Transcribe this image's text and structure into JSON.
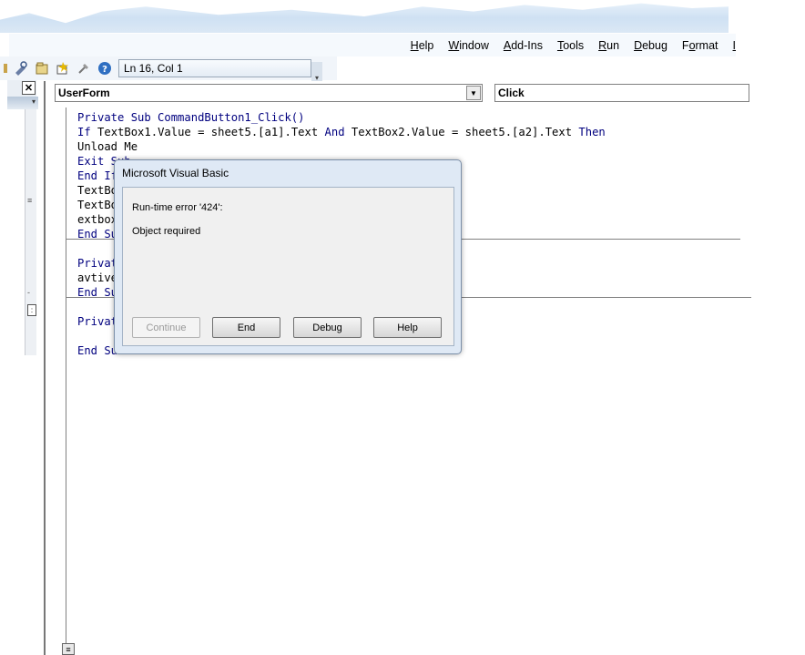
{
  "menu": {
    "items": [
      {
        "pre": "",
        "u": "H",
        "post": "elp"
      },
      {
        "pre": "",
        "u": "W",
        "post": "indow"
      },
      {
        "pre": "",
        "u": "A",
        "post": "dd-Ins"
      },
      {
        "pre": "",
        "u": "T",
        "post": "ools"
      },
      {
        "pre": "",
        "u": "R",
        "post": "un"
      },
      {
        "pre": "",
        "u": "D",
        "post": "ebug"
      },
      {
        "pre": "F",
        "u": "o",
        "post": "rmat"
      },
      {
        "pre": "",
        "u": "I",
        "post": ""
      }
    ]
  },
  "toolbar": {
    "position": "Ln 16, Col 1"
  },
  "combos": {
    "object": "UserForm",
    "procedure": "Click"
  },
  "code": {
    "lines": [
      "Private Sub CommandButton1_Click()",
      "If TextBox1.Value = sheet5.[a1].Text And TextBox2.Value = sheet5.[a2].Text Then",
      "Unload Me",
      "Exit Sub",
      "End If",
      "TextBo",
      "TextBo",
      "extbox",
      "End Su",
      "Privat",
      "avtive",
      "End Su",
      "Privat",
      "End Su"
    ]
  },
  "dialog": {
    "title": "Microsoft Visual Basic",
    "error_code": "Run-time error '424':",
    "message": "Object required",
    "buttons": {
      "continue": "Continue",
      "end": "End",
      "debug": "Debug",
      "help": "Help"
    }
  }
}
